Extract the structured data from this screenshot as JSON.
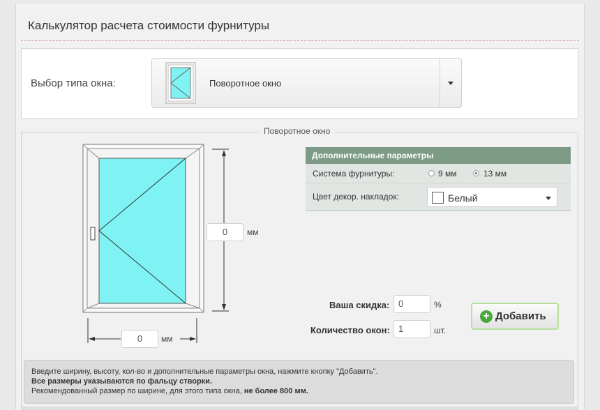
{
  "title": "Калькулятор расчета стоимости фурнитуры",
  "window_type": {
    "label": "Выбор типа окна:",
    "selected": "Поворотное окно",
    "thumb_icon": "swing-window-icon"
  },
  "section_legend": "Поворотное окно",
  "dimensions": {
    "height_value": "0",
    "height_unit": "мм",
    "width_value": "0",
    "width_unit": "мм"
  },
  "params": {
    "header": "Дополнительные параметры",
    "system_label": "Система фурнитуры:",
    "system_options": [
      "9 мм",
      "13 мм"
    ],
    "system_selected": "13 мм",
    "color_label": "Цвет декор. накладок:",
    "color_value": "Белый"
  },
  "discount": {
    "label": "Ваша скидка:",
    "value": "0",
    "unit": "%"
  },
  "count": {
    "label": "Количество окон:",
    "value": "1",
    "unit": "шт."
  },
  "add_button": "Добавить",
  "info": {
    "line1": "Введите ширину, высоту, кол-во и дополнительные параметры окна, нажмите кнопку \"Добавить\".",
    "line2": "Все размеры указываются по фальцу створки.",
    "line3_prefix": "Рекомендованный размер по ширине, для этого типа окна, ",
    "line3_bold": "не более 800 мм."
  },
  "colors": {
    "glass": "#7ff3f3",
    "header_green": "#7c9a86",
    "accent_green": "#4aa83b"
  }
}
